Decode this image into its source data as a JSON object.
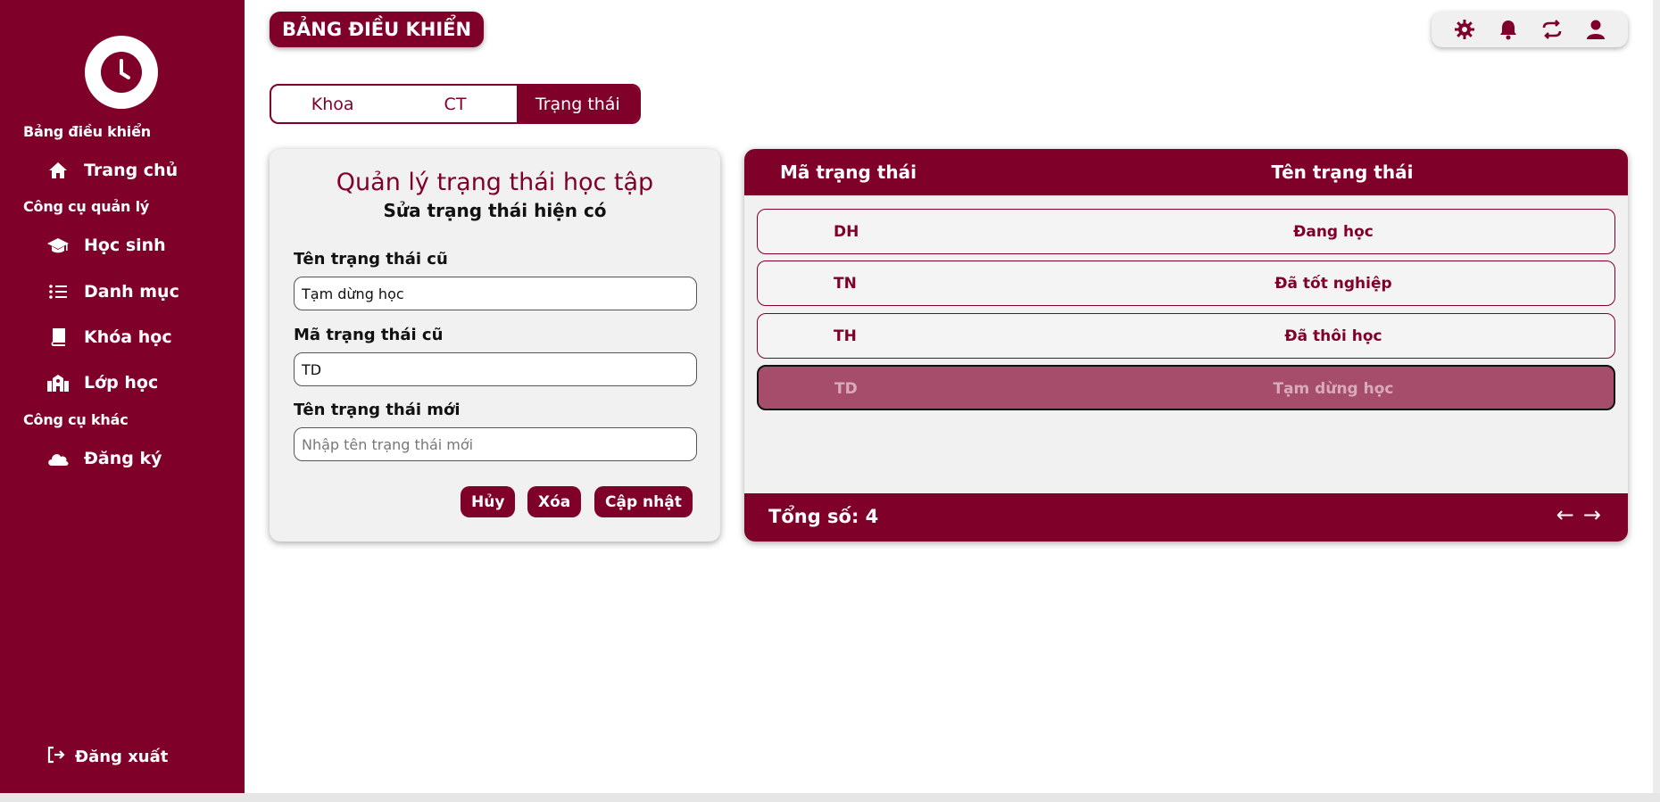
{
  "sidebar": {
    "section_dashboard": "Bảng điều khiển",
    "section_tools": "Công cụ quản lý",
    "section_other": "Công cụ khác",
    "items": [
      {
        "label": "Trang chủ",
        "icon": "home-icon"
      },
      {
        "label": "Học sinh",
        "icon": "graduation-cap-icon"
      },
      {
        "label": "Danh mục",
        "icon": "list-icon"
      },
      {
        "label": "Khóa học",
        "icon": "book-icon"
      },
      {
        "label": "Lớp học",
        "icon": "school-icon"
      },
      {
        "label": "Đăng ký",
        "icon": "cloud-icon"
      }
    ],
    "logout": "Đăng xuất"
  },
  "header": {
    "title": "BẢNG ĐIỀU KHIỂN",
    "icons": [
      "settings-icon",
      "bell-icon",
      "sync-icon",
      "user-icon"
    ]
  },
  "tabs": [
    {
      "label": "Khoa",
      "active": false
    },
    {
      "label": "CT",
      "active": false
    },
    {
      "label": "Trạng thái",
      "active": true
    }
  ],
  "form": {
    "title": "Quản lý trạng thái học tập",
    "subtitle": "Sửa trạng thái hiện có",
    "old_name_label": "Tên trạng thái cũ",
    "old_name_value": "Tạm dừng học",
    "old_code_label": "Mã trạng thái cũ",
    "old_code_value": "TD",
    "new_name_label": "Tên trạng thái mới",
    "new_name_placeholder": "Nhập tên trạng thái mới",
    "cancel": "Hủy",
    "delete": "Xóa",
    "update": "Cập nhật"
  },
  "table": {
    "col_code": "Mã trạng thái",
    "col_name": "Tên trạng thái",
    "rows": [
      {
        "code": "DH",
        "name": "Đang học",
        "selected": false
      },
      {
        "code": "TN",
        "name": "Đã tốt nghiệp",
        "selected": false
      },
      {
        "code": "TH",
        "name": "Đã thôi học",
        "selected": false
      },
      {
        "code": "TD",
        "name": "Tạm dừng học",
        "selected": true
      }
    ],
    "total": "Tổng số: 4",
    "prev": "←",
    "next": "→"
  },
  "colors": {
    "brand": "#7f0029",
    "selected_row": "#a64d6b",
    "card": "#f1f1f1"
  }
}
